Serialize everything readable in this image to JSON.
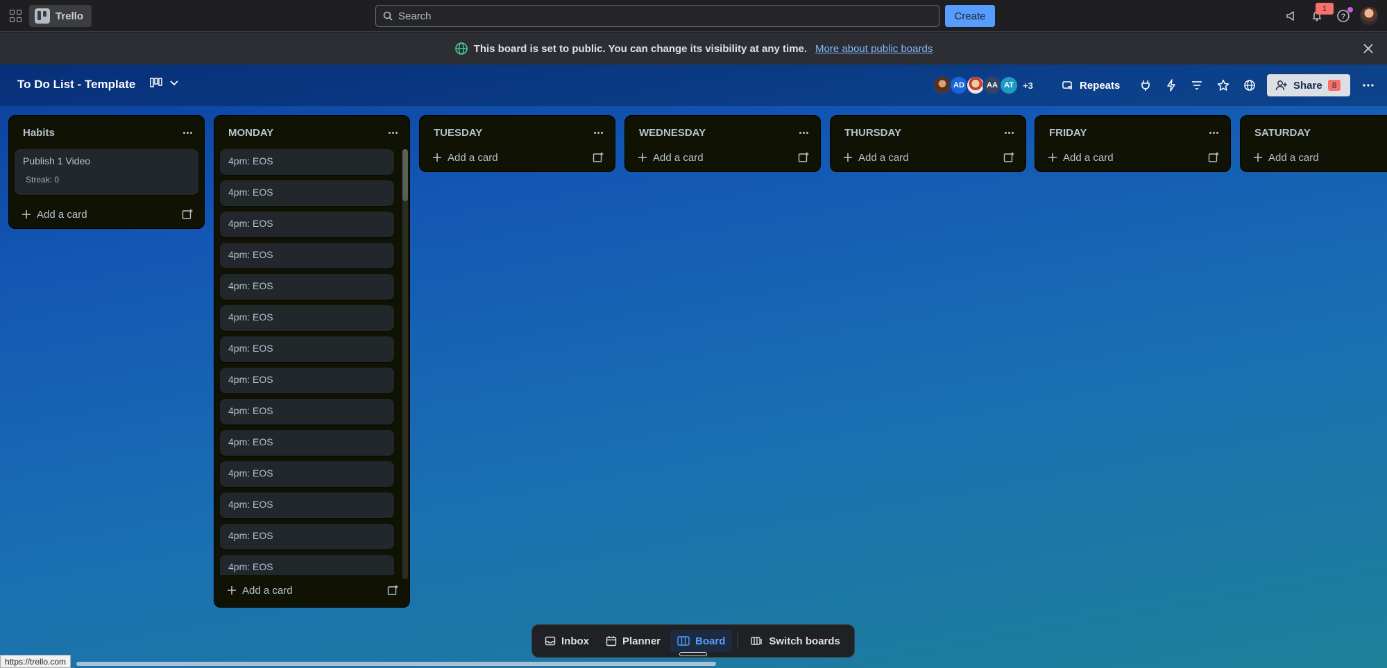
{
  "nav": {
    "logo_text": "Trello",
    "search_placeholder": "Search",
    "create_label": "Create",
    "notification_count": "1"
  },
  "banner": {
    "message": "This board is set to public. You can change its visibility at any time.",
    "link": "More about public boards"
  },
  "board": {
    "title": "To Do List - Template",
    "members": [
      "",
      "AD",
      "",
      "AA",
      "AT"
    ],
    "members_more": "+3",
    "repeats_label": "Repeats",
    "share_label": "Share",
    "share_count": "8"
  },
  "lists": [
    {
      "title": "Habits",
      "add_label": "Add a card",
      "cards": [
        {
          "title": "Publish 1 Video",
          "sub": "Streak: 0"
        }
      ]
    },
    {
      "title": "MONDAY",
      "add_label": "Add a card",
      "cards": [
        {
          "title": "4pm: EOS"
        },
        {
          "title": "4pm: EOS"
        },
        {
          "title": "4pm: EOS"
        },
        {
          "title": "4pm: EOS"
        },
        {
          "title": "4pm: EOS"
        },
        {
          "title": "4pm: EOS"
        },
        {
          "title": "4pm: EOS"
        },
        {
          "title": "4pm: EOS"
        },
        {
          "title": "4pm: EOS"
        },
        {
          "title": "4pm: EOS"
        },
        {
          "title": "4pm: EOS"
        },
        {
          "title": "4pm: EOS"
        },
        {
          "title": "4pm: EOS"
        },
        {
          "title": "4pm: EOS"
        }
      ]
    },
    {
      "title": "TUESDAY",
      "add_label": "Add a card",
      "cards": []
    },
    {
      "title": "WEDNESDAY",
      "add_label": "Add a card",
      "cards": []
    },
    {
      "title": "THURSDAY",
      "add_label": "Add a card",
      "cards": []
    },
    {
      "title": "FRIDAY",
      "add_label": "Add a card",
      "cards": []
    },
    {
      "title": "SATURDAY",
      "add_label": "Add a card",
      "cards": []
    }
  ],
  "dock": {
    "inbox": "Inbox",
    "planner": "Planner",
    "board": "Board",
    "switch": "Switch boards"
  },
  "status_url": "https://trello.com",
  "colors": {
    "accent": "#579dff",
    "list_bg": "#101204",
    "card_bg": "#22272b"
  }
}
